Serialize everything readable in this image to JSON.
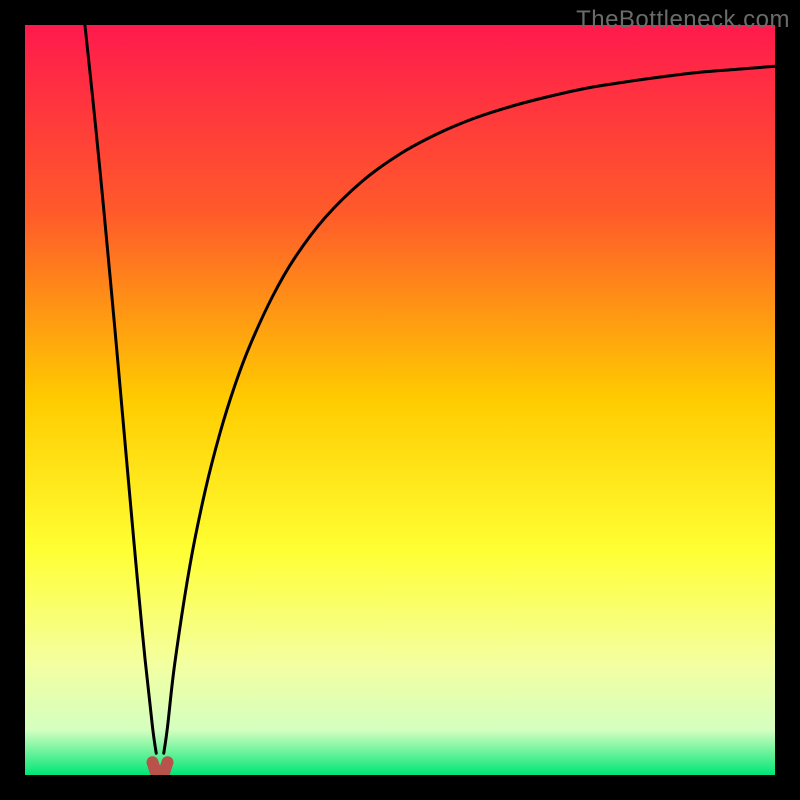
{
  "watermark": "TheBottleneck.com",
  "chart_data": {
    "type": "line",
    "title": "",
    "xlabel": "",
    "ylabel": "",
    "xlim": [
      0,
      100
    ],
    "ylim": [
      0,
      100
    ],
    "x_optimum": 18,
    "gradient_stops": [
      {
        "offset": 0.0,
        "color": "#ff1a4d"
      },
      {
        "offset": 0.25,
        "color": "#ff5a2a"
      },
      {
        "offset": 0.5,
        "color": "#ffcc00"
      },
      {
        "offset": 0.7,
        "color": "#ffff33"
      },
      {
        "offset": 0.85,
        "color": "#f4ffa0"
      },
      {
        "offset": 0.94,
        "color": "#d4ffc0"
      },
      {
        "offset": 1.0,
        "color": "#00e676"
      }
    ],
    "series": [
      {
        "name": "left-branch",
        "x": [
          8,
          9,
          10,
          11,
          12,
          13,
          14,
          15,
          16,
          17,
          17.5
        ],
        "values": [
          99.9,
          90.5,
          80.6,
          70.1,
          59.3,
          48.1,
          36.9,
          25.9,
          15.5,
          6.4,
          2.9
        ]
      },
      {
        "name": "right-branch",
        "x": [
          18.5,
          19,
          20,
          22,
          24,
          26,
          28,
          30,
          33,
          36,
          40,
          45,
          50,
          55,
          60,
          65,
          70,
          75,
          80,
          85,
          90,
          95,
          100
        ],
        "values": [
          2.9,
          6.4,
          15.1,
          28.0,
          37.8,
          45.6,
          52.0,
          57.3,
          63.8,
          69.0,
          74.3,
          79.2,
          82.8,
          85.5,
          87.6,
          89.2,
          90.5,
          91.6,
          92.4,
          93.1,
          93.7,
          94.1,
          94.5
        ]
      },
      {
        "name": "bottom-bump",
        "x": [
          17.0,
          17.4,
          17.8,
          18.2,
          18.6,
          19.0
        ],
        "values": [
          1.7,
          0.5,
          0.3,
          0.3,
          0.5,
          1.7
        ]
      }
    ]
  }
}
